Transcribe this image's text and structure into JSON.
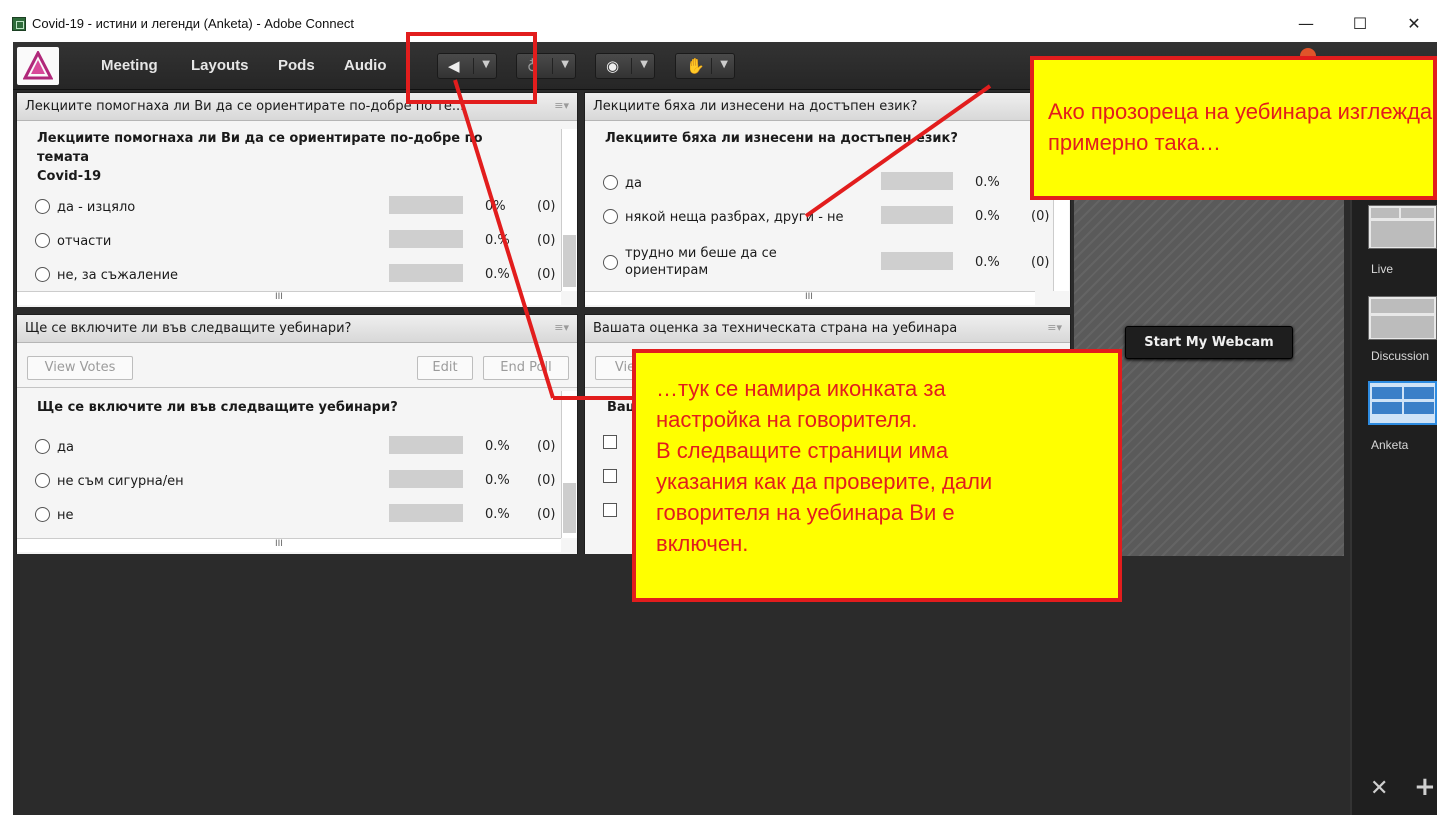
{
  "window": {
    "title": "Covid-19 - истини и легенди (Anketa) - Adobe Connect",
    "minimize": "—",
    "maximize": "☐",
    "close": "✕"
  },
  "menubar": {
    "items": [
      "Meeting",
      "Layouts",
      "Pods",
      "Audio"
    ],
    "tool_buttons": [
      "speaker-icon",
      "microphone-icon",
      "webcam-icon",
      "raise-hand-icon"
    ]
  },
  "pods": {
    "poll1": {
      "title": "Лекциите помогнаха ли Ви да се ориентирате по-добре по те...",
      "question_line1": "Лекциите помогнаха ли Ви да се ориентирате по-добре по темата",
      "question_line2": "Covid-19",
      "options": [
        {
          "label": "да - изцяло",
          "percent": "0%",
          "count": "(0)"
        },
        {
          "label": "отчасти",
          "percent": "0.%",
          "count": "(0)"
        },
        {
          "label": "не, за съжаление",
          "percent": "0.%",
          "count": "(0)"
        }
      ]
    },
    "poll2": {
      "title": "Лекциите бяха ли изнесени на достъпен език?",
      "question": "Лекциите бяха ли изнесени на достъпен език?",
      "options": [
        {
          "label": "да",
          "percent": "0.%",
          "count": ""
        },
        {
          "label": "някой неща разбрах, други - не",
          "percent": "0.%",
          "count": "(0)"
        },
        {
          "label_line1": "трудно ми беше да се",
          "label_line2": "ориентирам",
          "percent": "0.%",
          "count": "(0)"
        }
      ]
    },
    "poll3": {
      "title": "Ще се включите ли във следващите уебинари?",
      "view_votes": "View Votes",
      "edit": "Edit",
      "end_poll": "End Poll",
      "question": "Ще се включите ли във следващите уебинари?",
      "options": [
        {
          "label": "да",
          "percent": "0.%",
          "count": "(0)"
        },
        {
          "label": "не съм сигурна/ен",
          "percent": "0.%",
          "count": "(0)"
        },
        {
          "label": "не",
          "percent": "0.%",
          "count": "(0)"
        }
      ]
    },
    "poll4": {
      "title": "Вашата оценка за техническата страна на уебинара",
      "view_partial": "Vie",
      "question_partial": "Ваш"
    },
    "webcam": {
      "button": "Start My Webcam"
    }
  },
  "layouts": {
    "items": [
      "Live",
      "Discussion",
      "Anketa"
    ]
  },
  "annotations": {
    "top": "Ако прозореца на уебинара изглежда примерно така…",
    "middle_line1": "…тук се намира иконката за",
    "middle_line2": "настройка на говорителя.",
    "middle_line3": "В следващите страници има",
    "middle_line4": "указания как да проверите, дали",
    "middle_line5": "говорителя на уебинара Ви е",
    "middle_line6": "включен."
  },
  "colors": {
    "annotation_border": "#e21d1d",
    "annotation_fill": "#ffff00",
    "menubar": "#2b2b2b"
  }
}
